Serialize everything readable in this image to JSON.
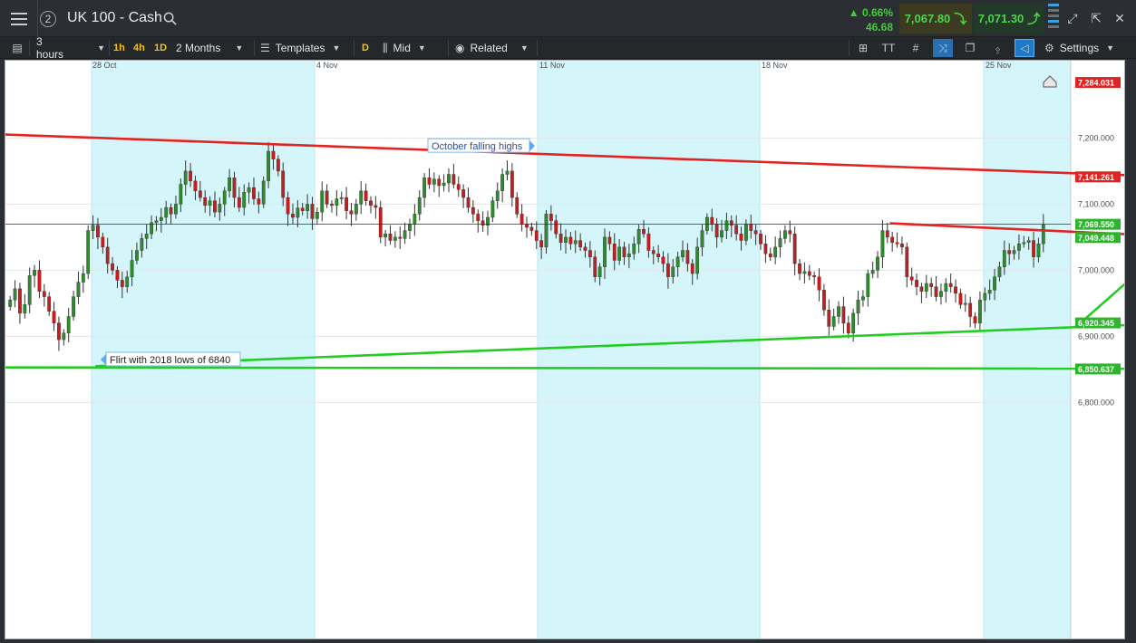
{
  "header": {
    "instrument_title": "UK 100 - Cash",
    "panel_number": "2",
    "change_percent": "0.66%",
    "change_points": "46.68",
    "sell_price": "7,067.80",
    "buy_price": "7,071.30",
    "up_color": "#3fcf35"
  },
  "toolbar": {
    "interval_label": "3 hours",
    "tf_1h": "1h",
    "tf_4h": "4h",
    "tf_1d": "1D",
    "range_label": "2 Months",
    "templates_label": "Templates",
    "d_label": "D",
    "price_type_label": "Mid",
    "related_label": "Related",
    "settings_label": "Settings",
    "text_tool_label": "TT"
  },
  "chart_data": {
    "type": "candlestick",
    "title": "",
    "xlabel": "",
    "ylabel": "",
    "ylim": [
      6800,
      7300
    ],
    "x_tick_labels": [
      "28 Oct",
      "4 Nov",
      "11 Nov",
      "18 Nov",
      "25 Nov"
    ],
    "y_tick_labels": [
      "7,200.000",
      "7,100.000",
      "7,000.000",
      "6,900.000",
      "6,800.000"
    ],
    "y_tick_values": [
      7200,
      7100,
      7000,
      6900,
      6800
    ],
    "current_price_line": 7069.55,
    "price_badges": [
      {
        "label": "7,284.031",
        "value": 7284.031,
        "color": "#e32222"
      },
      {
        "label": "7,141.261",
        "value": 7141.261,
        "color": "#e32222"
      },
      {
        "label": "7,069.550",
        "value": 7069.55,
        "color": "#2db52d"
      },
      {
        "label": "7,049.448",
        "value": 7049.448,
        "color": "#2db52d"
      },
      {
        "label": "6,920.345",
        "value": 6920.345,
        "color": "#2db52d"
      },
      {
        "label": "6,850.637",
        "value": 6850.637,
        "color": "#2db52d"
      }
    ],
    "trendlines": [
      {
        "color": "red",
        "from": [
          -3,
          7206
        ],
        "to": [
          240,
          7141
        ]
      },
      {
        "color": "red",
        "from": [
          181,
          7071
        ],
        "to": [
          234,
          7053
        ]
      },
      {
        "color": "green",
        "from": [
          18,
          6855
        ],
        "to": [
          240,
          6920
        ]
      },
      {
        "color": "green",
        "from": [
          219,
          6913
        ],
        "to": [
          240,
          7049
        ]
      },
      {
        "color": "green",
        "from": [
          -3,
          6853
        ],
        "to": [
          240,
          6851
        ]
      }
    ],
    "annotations": [
      {
        "text": "October falling highs",
        "value": 7188,
        "color": "#2a4fa8"
      },
      {
        "text": "Flirt with 2018 lows of 6840",
        "value": 6865,
        "color": "#222222"
      }
    ],
    "up_color": "#2e8b2e",
    "down_color": "#c41e1e",
    "grid": true
  },
  "icons": {
    "home_marker": "home-marker-icon"
  }
}
